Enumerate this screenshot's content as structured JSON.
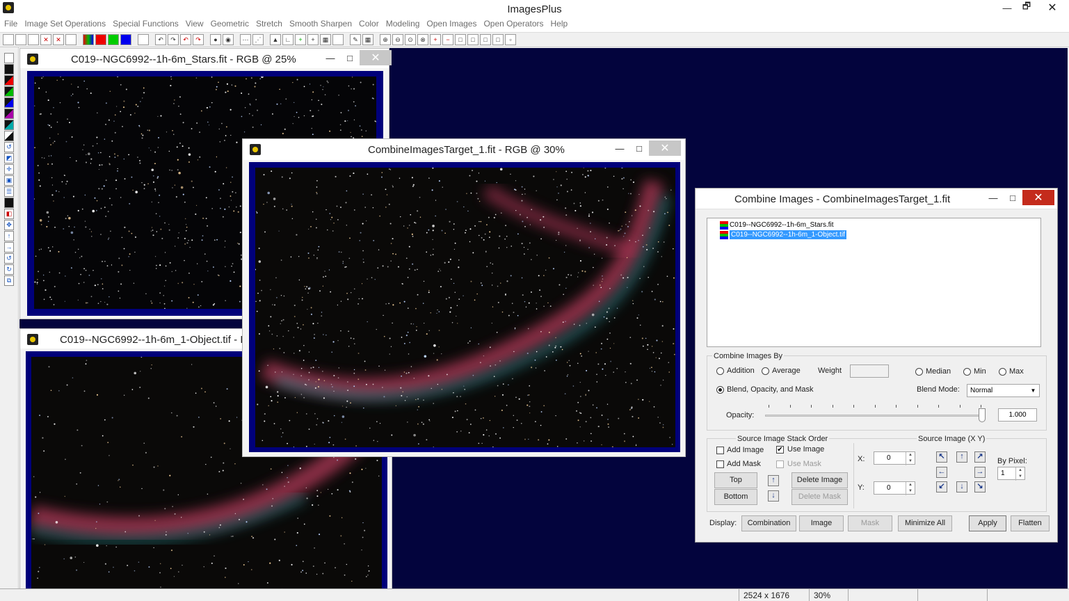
{
  "app": {
    "title": "ImagesPlus",
    "min": "—",
    "restore": "🗗",
    "close": "✕"
  },
  "menu": [
    "File",
    "Image Set Operations",
    "Special Functions",
    "View",
    "Geometric",
    "Stretch",
    "Smooth Sharpen",
    "Color",
    "Modeling",
    "Open Images",
    "Open Operators",
    "Help"
  ],
  "status": {
    "dimensions": "2524 x 1676",
    "zoom": "30%"
  },
  "win_stars": {
    "title": "C019--NGC6992--1h-6m_Stars.fit - RGB @ 25%"
  },
  "win_object": {
    "title": "C019--NGC6992--1h-6m_1-Object.tif - I"
  },
  "win_target": {
    "title": "CombineImagesTarget_1.fit - RGB @ 30%"
  },
  "dialog": {
    "title": "Combine Images - CombineImagesTarget_1.fit",
    "tree": [
      "C019--NGC6992--1h-6m_Stars.fit",
      "C019--NGC6992--1h-6m_1-Object.tif"
    ],
    "combine_by": {
      "label": "Combine Images By",
      "addition": "Addition",
      "average": "Average",
      "weight": "Weight",
      "weight_value": "",
      "median": "Median",
      "min": "Min",
      "max": "Max",
      "blend": "Blend, Opacity, and Mask",
      "blend_mode_label": "Blend Mode:",
      "blend_mode": "Normal",
      "opacity_label": "Opacity:",
      "opacity": "1.000"
    },
    "stack": {
      "label": "Source Image Stack Order",
      "add_image": "Add Image",
      "use_image": "Use Image",
      "add_mask": "Add Mask",
      "use_mask": "Use Mask",
      "top": "Top",
      "bottom": "Bottom",
      "delete_image": "Delete Image",
      "delete_mask": "Delete Mask",
      "x_label": "X:",
      "y_label": "Y:",
      "x": "0",
      "y": "0"
    },
    "source": {
      "label": "Source Image (X Y)",
      "by_pixel": "By Pixel:",
      "pixel": "1"
    },
    "display_label": "Display:",
    "buttons": {
      "combination": "Combination",
      "image": "Image",
      "mask": "Mask",
      "minimize_all": "Minimize All",
      "apply": "Apply",
      "flatten": "Flatten"
    }
  }
}
